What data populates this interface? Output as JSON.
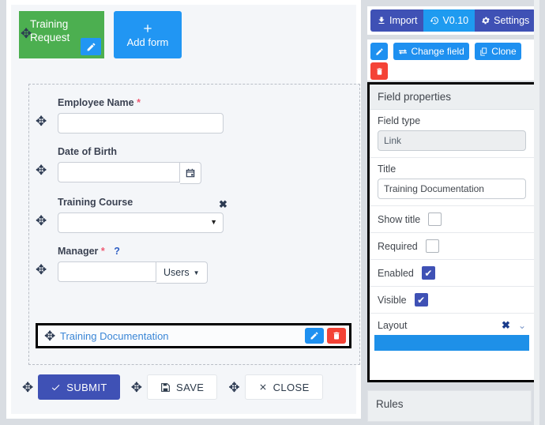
{
  "form_tab": {
    "label": "Training Request",
    "edit_icon": "pencil-icon",
    "drag_icon": "move-icon"
  },
  "add_form_button": {
    "label": "Add form",
    "icon": "plus-icon"
  },
  "form_fields": [
    {
      "label": "Employee Name",
      "required": true,
      "required_marker": "*",
      "type": "text",
      "value": "",
      "drag_icon": "move-icon"
    },
    {
      "label": "Date of Birth",
      "required": false,
      "required_marker": "",
      "type": "date",
      "value": "",
      "icon": "calendar-icon",
      "drag_icon": "move-icon"
    },
    {
      "label": "Training Course",
      "required": false,
      "required_marker": "",
      "type": "select",
      "value": "",
      "clear_icon": "close-x-icon",
      "caret_icon": "caret-down-icon",
      "drag_icon": "move-icon"
    },
    {
      "label": "Manager",
      "required": true,
      "required_marker": "*",
      "help_marker": "?",
      "type": "lookup",
      "value": "",
      "lookup_label": "Users",
      "caret_icon": "caret-down-icon",
      "drag_icon": "move-icon"
    }
  ],
  "selected_field": {
    "link_text": "Training Documentation",
    "drag_icon": "move-icon",
    "edit_icon": "pencil-icon",
    "delete_icon": "trash-icon"
  },
  "footer": {
    "submit_label": "SUBMIT",
    "submit_icon": "check-icon",
    "save_label": "SAVE",
    "save_icon": "floppy-disk-icon",
    "close_label": "CLOSE",
    "close_icon": "close-x-icon",
    "drag_icon": "move-icon"
  },
  "toolbar": {
    "import_label": "Import",
    "import_icon": "download-icon",
    "version_label": "V0.10",
    "version_icon": "history-icon",
    "settings_label": "Settings",
    "settings_icon": "gear-icon"
  },
  "field_toolbar": {
    "edit_icon": "pencil-icon",
    "change_field_label": "Change field",
    "change_field_icon": "exchange-icon",
    "clone_label": "Clone",
    "clone_icon": "copy-icon",
    "delete_icon": "trash-icon"
  },
  "field_properties": {
    "title": "Field properties",
    "field_type_label": "Field type",
    "field_type_value": "Link",
    "title_label": "Title",
    "title_value": "Training Documentation",
    "show_title_label": "Show title",
    "show_title_checked": false,
    "required_label": "Required",
    "required_checked": false,
    "enabled_label": "Enabled",
    "enabled_checked": true,
    "visible_label": "Visible",
    "visible_checked": true,
    "layout_label": "Layout",
    "layout_clear_icon": "close-x-icon",
    "layout_chevron_icon": "chevron-down-icon",
    "layout_value": ""
  },
  "rules": {
    "title": "Rules"
  },
  "colors": {
    "green_tab": "#4caf50",
    "blue_primary": "#2196f3",
    "blue_bright": "#1e90f0",
    "indigo": "#3f51b5",
    "red": "#f44336",
    "link": "#3a86d6",
    "required_star": "#ef5a73",
    "page_bg": "#d9dde2",
    "canvas_bg": "#f4f6f9"
  }
}
